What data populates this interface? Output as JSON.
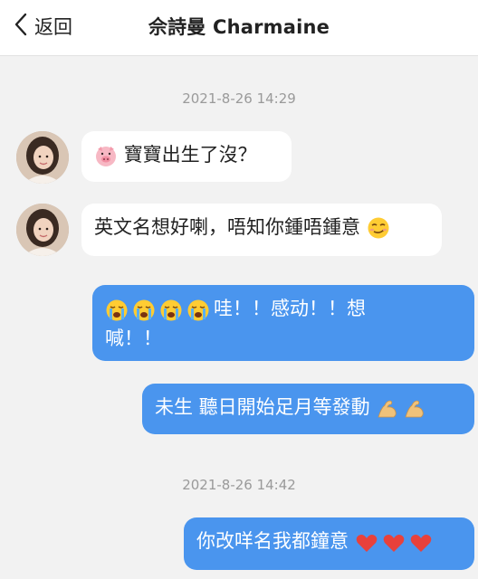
{
  "header": {
    "back_label": "返回",
    "title": "佘詩曼 Charmaine"
  },
  "timestamps": [
    "2021-8-26 14:29",
    "2021-8-26 14:42"
  ],
  "messages": [
    {
      "direction": "incoming",
      "text": "寶寶出生了沒？",
      "emoji_before": [
        "pig-face"
      ]
    },
    {
      "direction": "incoming",
      "text": "英文名想好喇，唔知你鍾唔鍾意",
      "emoji_after": [
        "smirk-face"
      ]
    },
    {
      "direction": "outgoing",
      "text_line1": "哇！！感动！！想",
      "text_line2": "喊！！",
      "emoji_before": [
        "crying-face",
        "crying-face",
        "crying-face",
        "crying-face"
      ]
    },
    {
      "direction": "outgoing",
      "text": "未生 聽日開始足月等發動",
      "emoji_after": [
        "flexed-biceps",
        "flexed-biceps"
      ]
    },
    {
      "direction": "outgoing",
      "text": "你改咩名我都鐘意",
      "emoji_after": [
        "red-heart",
        "red-heart",
        "red-heart"
      ]
    }
  ],
  "colors": {
    "outgoing_bubble": "#4a95ee",
    "incoming_bubble": "#ffffff",
    "background": "#f2f2f2"
  }
}
